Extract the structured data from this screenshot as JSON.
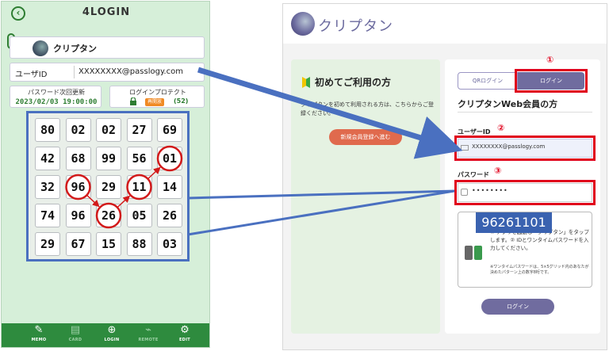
{
  "phone": {
    "app_logo": "4LOGIN",
    "service_name": "クリプタン",
    "userid_label": "ユーザID",
    "userid_value": "XXXXXXXX@passlogy.com",
    "pw_update_label": "パスワード次回更新",
    "pw_update_value": "2023/02/03 19:00:00",
    "protect_label": "ログインプロテクト",
    "protect_badge": "再開放",
    "protect_count": "(52)",
    "grid": [
      [
        "80",
        "02",
        "02",
        "27",
        "69"
      ],
      [
        "42",
        "68",
        "99",
        "56",
        "01"
      ],
      [
        "32",
        "96",
        "29",
        "11",
        "14"
      ],
      [
        "74",
        "96",
        "26",
        "05",
        "26"
      ],
      [
        "29",
        "67",
        "15",
        "88",
        "03"
      ]
    ],
    "nav": [
      {
        "glyph": "✎",
        "label": "MEMO",
        "icon": "memo-icon",
        "active": true
      },
      {
        "glyph": "▤",
        "label": "CARD",
        "icon": "card-icon",
        "active": false
      },
      {
        "glyph": "⊕",
        "label": "LOGIN",
        "icon": "globe-icon",
        "active": true
      },
      {
        "glyph": "⌁",
        "label": "REMOTE",
        "icon": "remote-icon",
        "active": false
      },
      {
        "glyph": "⚙",
        "label": "EDIT",
        "icon": "edit-icon",
        "active": true
      }
    ]
  },
  "web": {
    "logo_text": "クリプタン",
    "first_title": "初めてご利用の方",
    "first_desc": "クリプタンを初めて利用される方は、こちらからご登録ください。",
    "register_btn": "新規会員登録へ進む",
    "tab_qr": "QRログイン",
    "tab_login": "ログイン",
    "member_title": "クリプタンWeb会員の方",
    "uid_label": "ユーザーID",
    "uid_value": "XXXXXXXX@passlogy.com",
    "pw_label": "パスワード",
    "pw_dots": "••••••••",
    "help_text": "① アプリを起動し「クリプタン」をタップします。② IDとワンタイムパスワードを入力してください。",
    "help_small": "※ワンタイムパスワードは、5×5グリッド内のあなたが決めたパターン上の数字8桁です。",
    "submit_btn": "ログイン",
    "otp": "96261101",
    "steps": [
      "①",
      "②",
      "③"
    ]
  },
  "colors": {
    "accent_red": "#e0001b",
    "accent_blue": "#4a70c0",
    "app_green": "#2e8b3e",
    "brand_purple": "#706c9f"
  }
}
